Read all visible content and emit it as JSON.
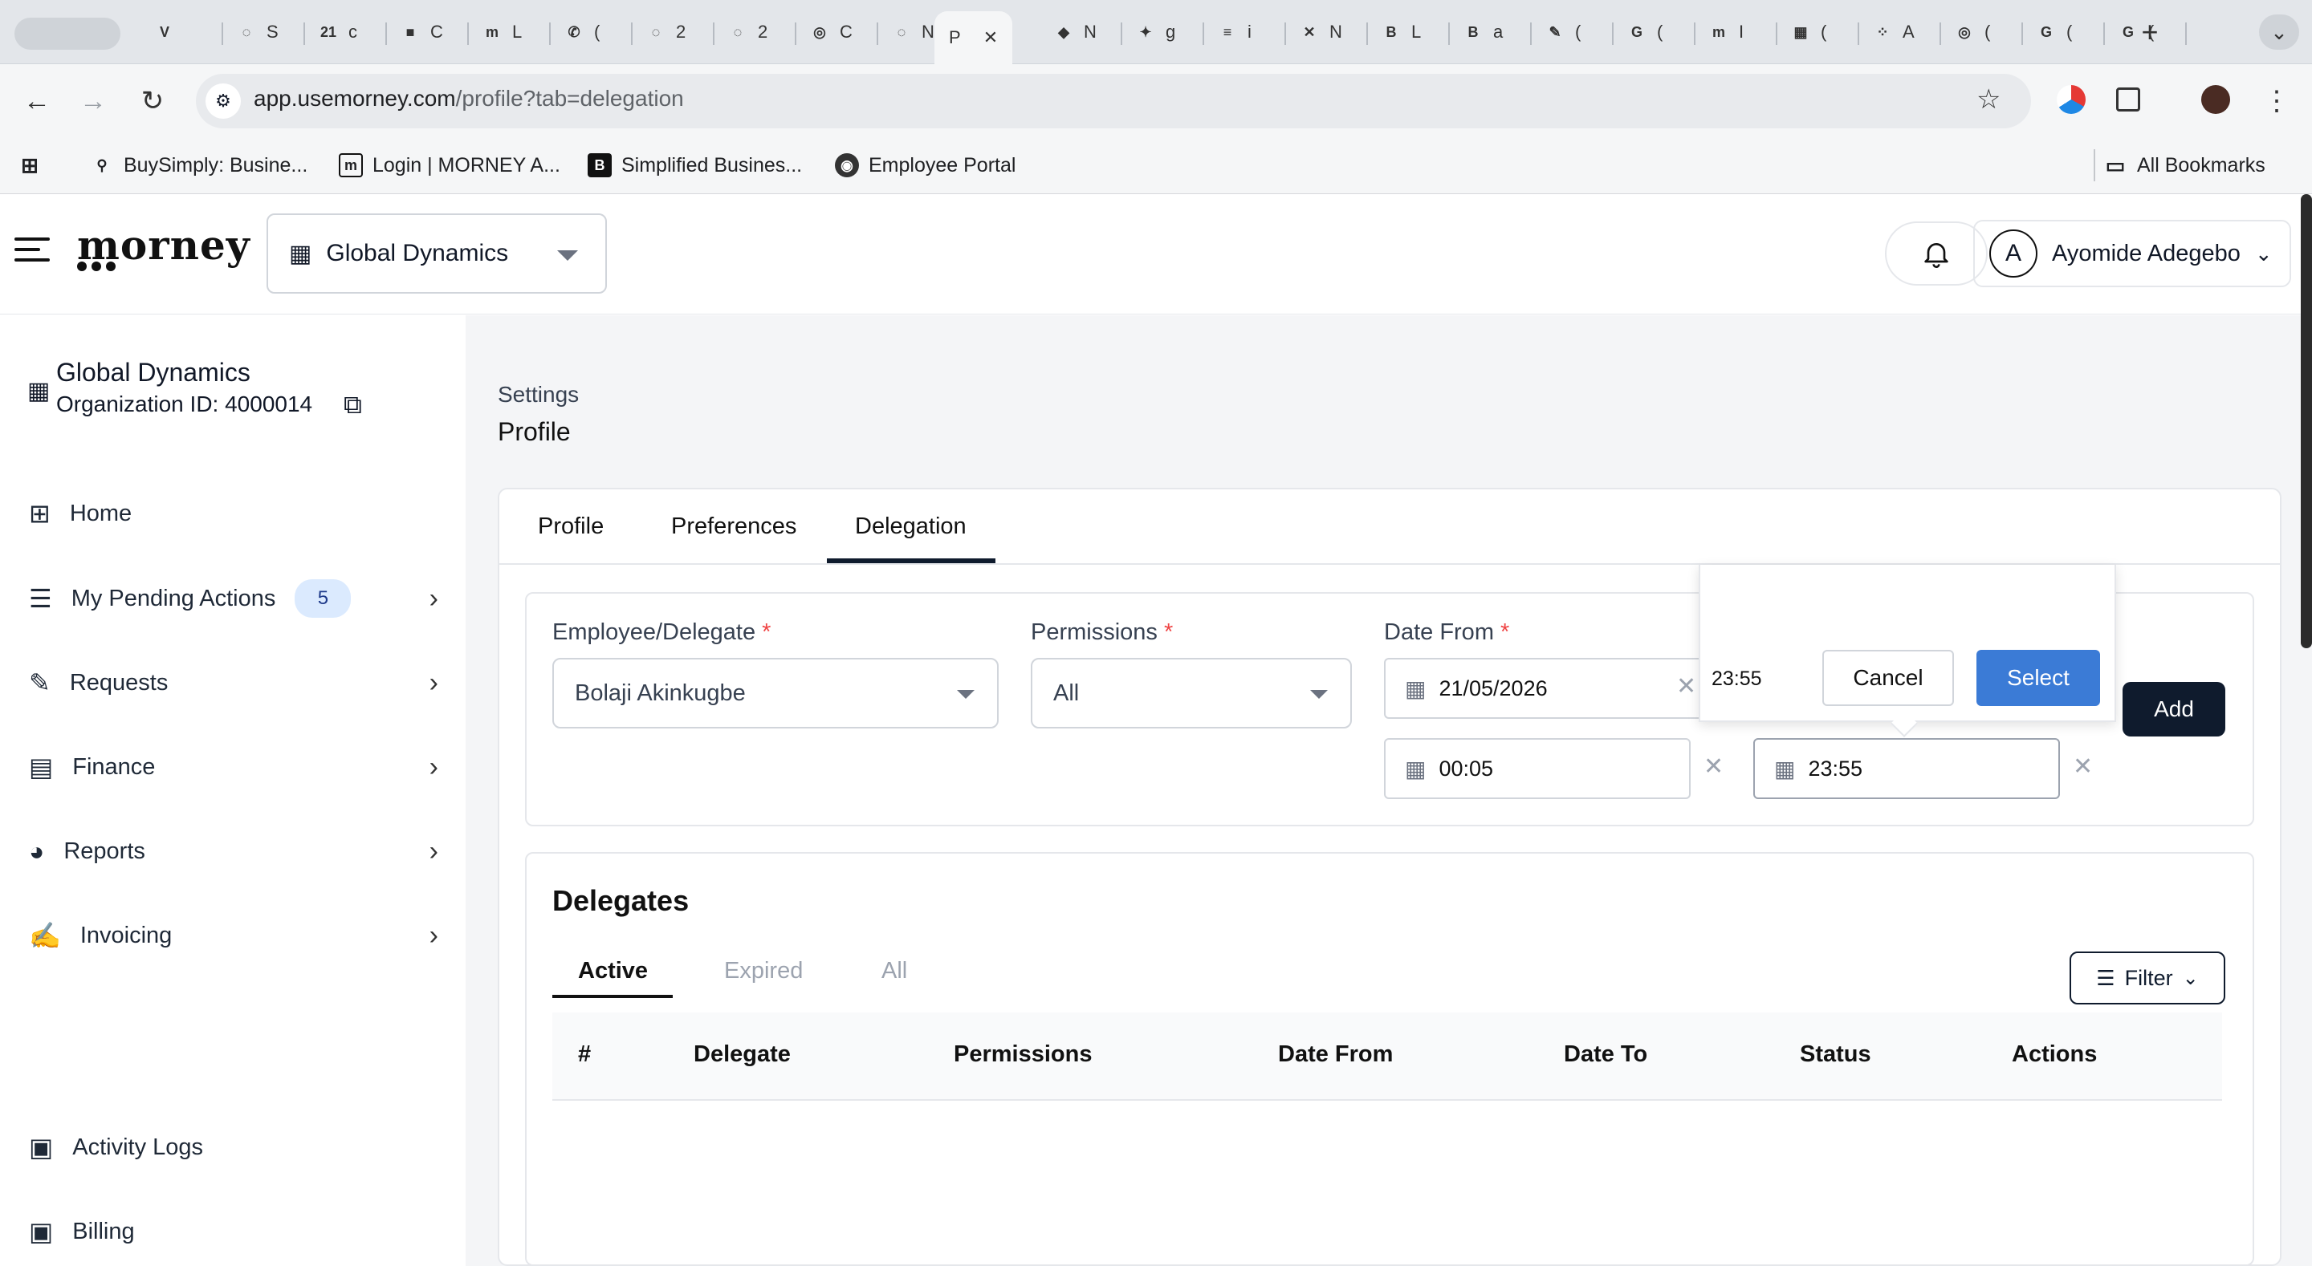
{
  "browser": {
    "active_tab_title": "P",
    "url_host": "app.usemorney.com",
    "url_path": "/profile?tab=delegation",
    "tabs": [
      {
        "icon": "V",
        "text": ""
      },
      {
        "icon": "◌",
        "text": "S"
      },
      {
        "icon": "21",
        "text": "c"
      },
      {
        "icon": "■",
        "text": "C"
      },
      {
        "icon": "m",
        "text": "L"
      },
      {
        "icon": "✆",
        "text": "("
      },
      {
        "icon": "◌",
        "text": "2"
      },
      {
        "icon": "◌",
        "text": "2"
      },
      {
        "icon": "◎",
        "text": "C"
      },
      {
        "icon": "◌",
        "text": "N"
      },
      {
        "icon": "◆",
        "text": "N"
      },
      {
        "icon": "✦",
        "text": "g"
      },
      {
        "icon": "≡",
        "text": "i"
      },
      {
        "icon": "✕",
        "text": "N"
      },
      {
        "icon": "B",
        "text": "L"
      },
      {
        "icon": "B",
        "text": "a"
      },
      {
        "icon": "✎",
        "text": "("
      },
      {
        "icon": "G",
        "text": "("
      },
      {
        "icon": "m",
        "text": "I"
      },
      {
        "icon": "▦",
        "text": "("
      },
      {
        "icon": "⁘",
        "text": "A"
      },
      {
        "icon": "◎",
        "text": "("
      },
      {
        "icon": "G",
        "text": "("
      },
      {
        "icon": "G",
        "text": "("
      }
    ],
    "bookmarks": [
      {
        "label": "BuySimply: Busine...",
        "icon": "bike"
      },
      {
        "label": "Login | MORNEY A...",
        "icon": "m"
      },
      {
        "label": "Simplified Busines...",
        "icon": "B"
      },
      {
        "label": "Employee Portal",
        "icon": "globe"
      }
    ],
    "all_bookmarks": "All Bookmarks"
  },
  "app": {
    "logo": "morney",
    "org_select": "Global Dynamics",
    "user_initial": "A",
    "user_name": "Ayomide Adegebo"
  },
  "sidebar": {
    "org_name": "Global Dynamics",
    "org_id": "Organization ID: 4000014",
    "items": [
      {
        "label": "Home",
        "icon": "grid-icon",
        "chevron": false
      },
      {
        "label": "My Pending Actions",
        "icon": "list-icon",
        "badge": "5",
        "chevron": true
      },
      {
        "label": "Requests",
        "icon": "edit-doc-icon",
        "chevron": true
      },
      {
        "label": "Finance",
        "icon": "finance-icon",
        "chevron": true
      },
      {
        "label": "Reports",
        "icon": "pie-chart-icon",
        "chevron": true
      },
      {
        "label": "Invoicing",
        "icon": "invoice-icon",
        "chevron": true
      },
      {
        "label": "Activity Logs",
        "icon": "money-icon",
        "chevron": false
      },
      {
        "label": "Billing",
        "icon": "money-icon",
        "chevron": false
      }
    ]
  },
  "page": {
    "breadcrumb": "Settings",
    "title": "Profile",
    "tabs": [
      "Profile",
      "Preferences",
      "Delegation"
    ],
    "active_tab": "Delegation"
  },
  "form": {
    "employee_label": "Employee/Delegate",
    "employee_value": "Bolaji Akinkugbe",
    "permissions_label": "Permissions",
    "permissions_value": "All",
    "date_from_label": "Date From",
    "date_from_value": "21/05/2026",
    "time_from_value": "00:05",
    "time_to_value": "23:55",
    "required_mark": "*",
    "add_label": "Add"
  },
  "time_picker": {
    "value": "23:55",
    "cancel_label": "Cancel",
    "select_label": "Select"
  },
  "delegates": {
    "title": "Delegates",
    "subtabs": [
      "Active",
      "Expired",
      "All"
    ],
    "active_subtab": "Active",
    "filter_label": "Filter",
    "columns": [
      "#",
      "Delegate",
      "Permissions",
      "Date From",
      "Date To",
      "Status",
      "Actions"
    ]
  },
  "colors": {
    "primary_dark": "#0f1b2d",
    "select_blue": "#3b7bd6",
    "required_red": "#ef4444",
    "badge_bg": "#dbeafe"
  }
}
